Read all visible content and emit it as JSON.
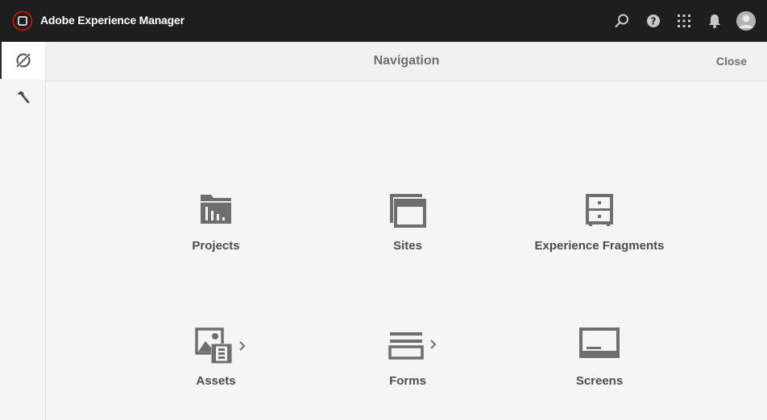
{
  "app": {
    "title": "Adobe Experience Manager"
  },
  "topbar": {
    "icons": [
      "search-icon",
      "help-icon",
      "solutions-grid-icon",
      "notifications-bell-icon",
      "user-avatar"
    ]
  },
  "rail": {
    "items": [
      "navigation-compass-icon",
      "tools-hammer-icon"
    ]
  },
  "header": {
    "title": "Navigation",
    "close_label": "Close"
  },
  "tiles": [
    {
      "label": "Projects",
      "icon": "projects-folder-icon"
    },
    {
      "label": "Sites",
      "icon": "sites-pages-icon"
    },
    {
      "label": "Experience Fragments",
      "icon": "experience-fragments-cabinet-icon"
    },
    {
      "label": "Assets",
      "icon": "assets-media-icon",
      "has_submenu": true
    },
    {
      "label": "Forms",
      "icon": "forms-icon",
      "has_submenu": true
    },
    {
      "label": "Screens",
      "icon": "screens-monitor-icon"
    }
  ],
  "colors": {
    "topbar_bg": "#1e1e1e",
    "brand_accent": "#eb1000",
    "icon_gray": "#6e6e6e",
    "page_bg": "#f5f5f5"
  }
}
